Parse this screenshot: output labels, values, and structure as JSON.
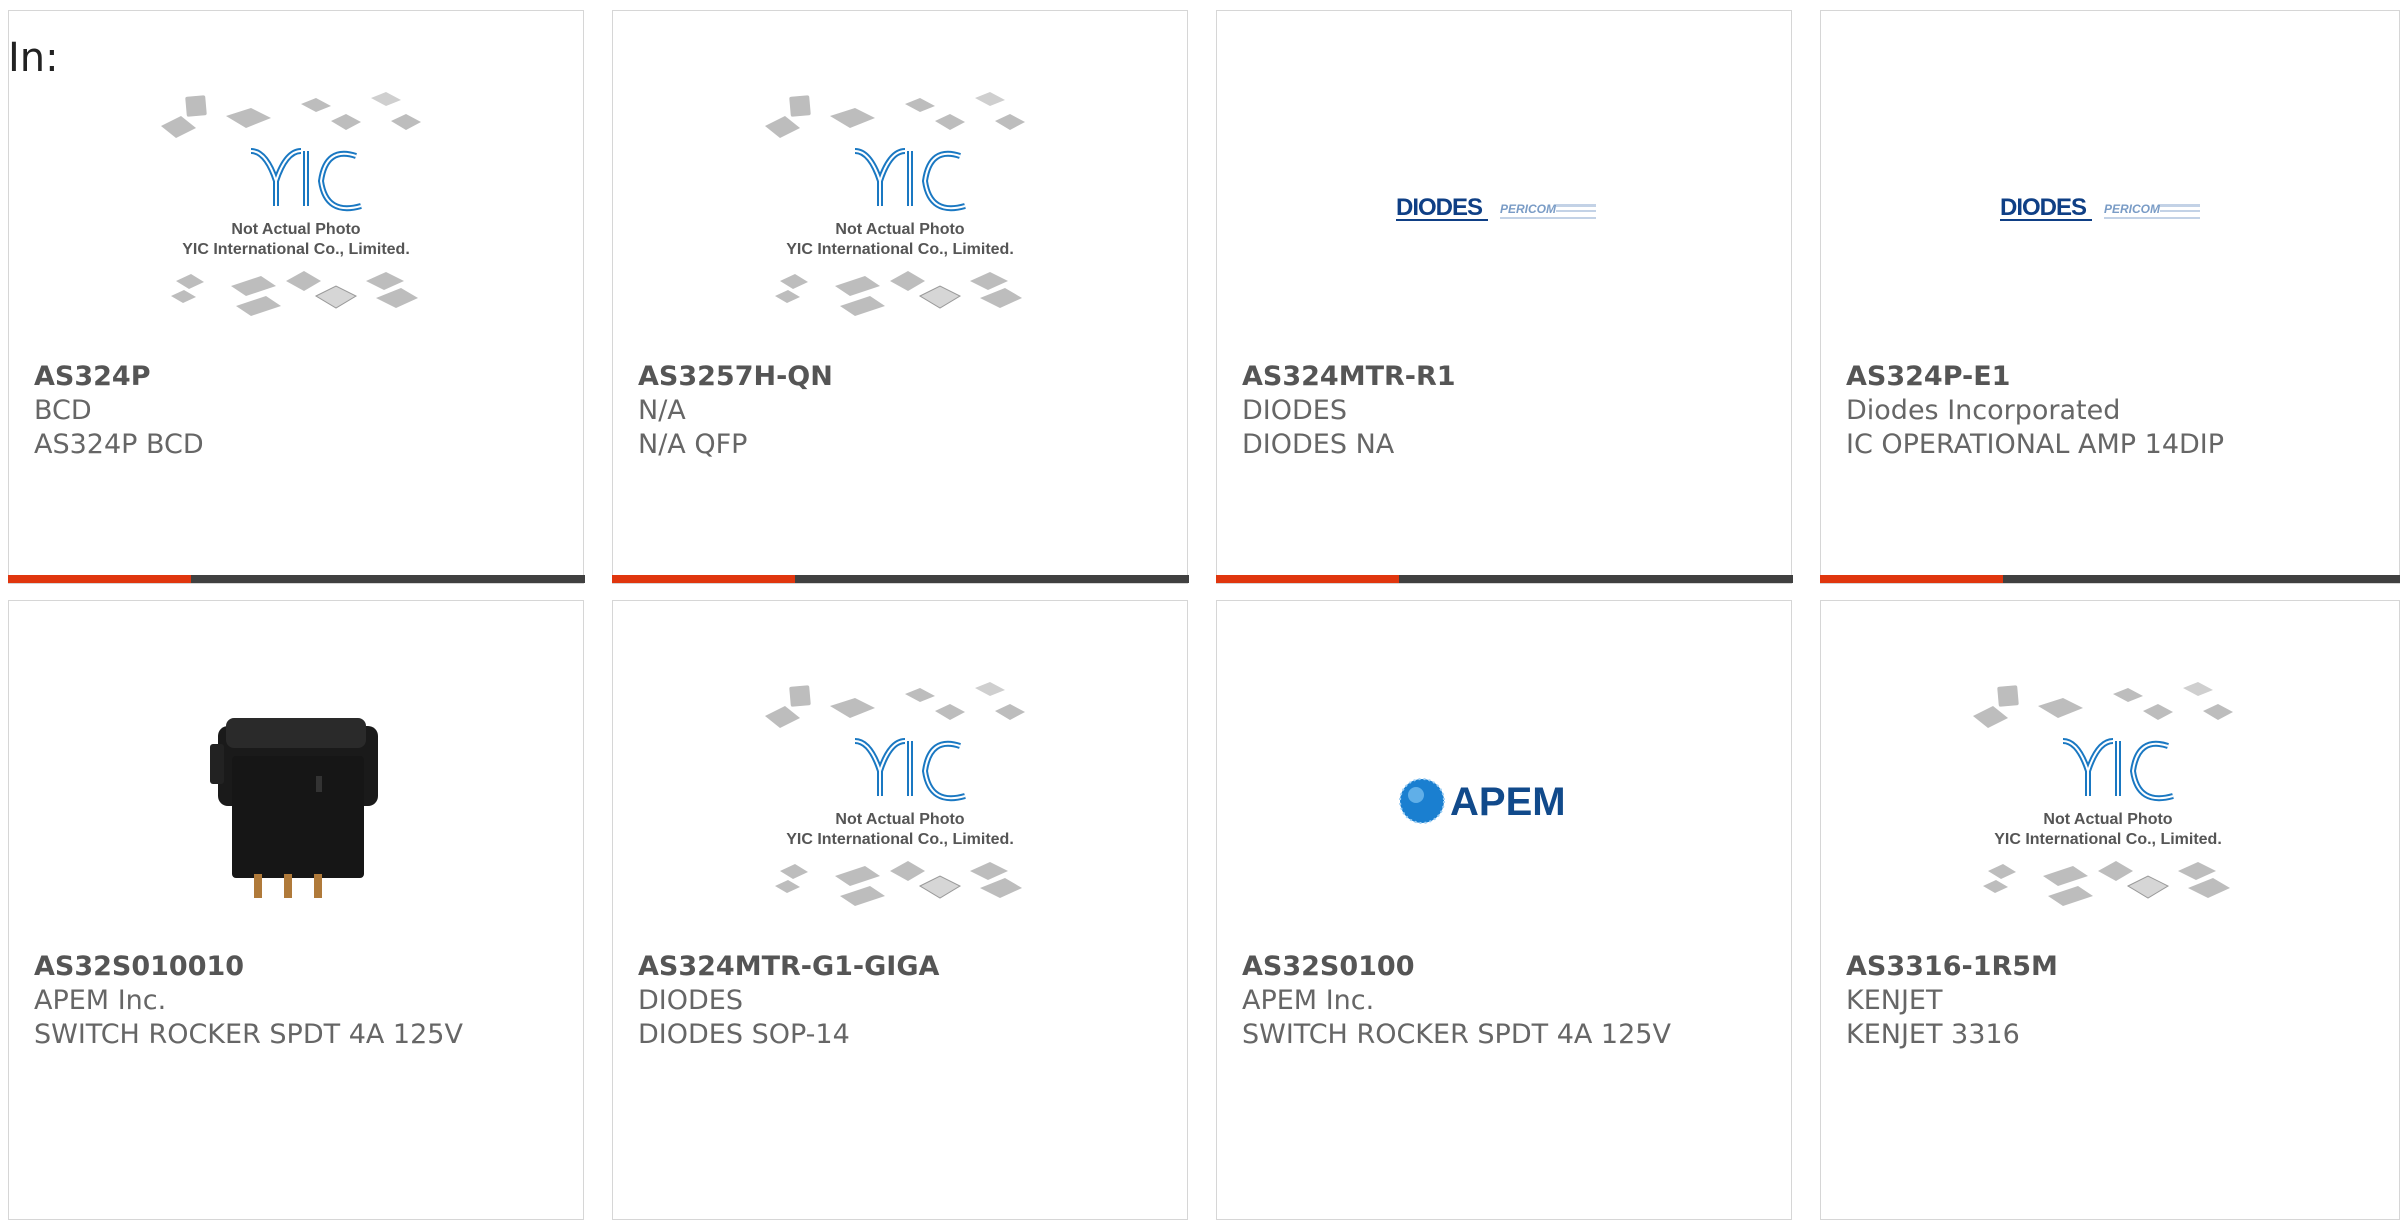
{
  "filter_label": "In:",
  "colors": {
    "accent_bar": "#e0360e",
    "dark_bar": "#404040",
    "yic_blue": "#1a78c2"
  },
  "products": [
    {
      "part": "AS324P",
      "manufacturer": "BCD",
      "description": "AS324P BCD",
      "image": "yic-placeholder"
    },
    {
      "part": "AS3257H-QN",
      "manufacturer": "N/A",
      "description": "N/A QFP",
      "image": "yic-placeholder"
    },
    {
      "part": "AS324MTR-R1",
      "manufacturer": "DIODES",
      "description": "DIODES NA",
      "image": "diodes-pericom-logo"
    },
    {
      "part": "AS324P-E1",
      "manufacturer": "Diodes Incorporated",
      "description": "IC OPERATIONAL AMP 14DIP",
      "image": "diodes-pericom-logo"
    },
    {
      "part": "AS32S010010",
      "manufacturer": "APEM Inc.",
      "description": "SWITCH ROCKER SPDT 4A 125V",
      "image": "rocker-switch-photo"
    },
    {
      "part": "AS324MTR-G1-GIGA",
      "manufacturer": "DIODES",
      "description": "DIODES SOP-14",
      "image": "yic-placeholder"
    },
    {
      "part": "AS32S0100",
      "manufacturer": "APEM Inc.",
      "description": "SWITCH ROCKER SPDT 4A 125V",
      "image": "apem-logo"
    },
    {
      "part": "AS3316-1R5M",
      "manufacturer": "KENJET",
      "description": "KENJET 3316",
      "image": "yic-placeholder"
    }
  ],
  "placeholder": {
    "line1": "Not Actual Photo",
    "line2": "YIC International Co., Limited.",
    "logo": "YIC"
  },
  "logos": {
    "diodes": "DIODES",
    "pericom": "PERICOM",
    "apem": "APEM"
  }
}
